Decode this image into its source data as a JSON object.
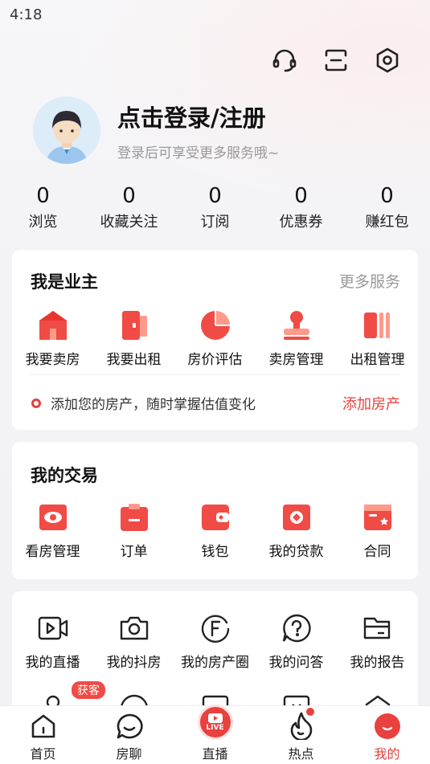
{
  "status": {
    "time": "4:18"
  },
  "header": {
    "title": "点击登录/注册",
    "subtitle": "登录后可享受更多服务哦~",
    "icons": [
      "headset-icon",
      "scan-icon",
      "settings-icon"
    ]
  },
  "stats": [
    {
      "value": "0",
      "label": "浏览"
    },
    {
      "value": "0",
      "label": "收藏关注"
    },
    {
      "value": "0",
      "label": "订阅"
    },
    {
      "value": "0",
      "label": "优惠券"
    },
    {
      "value": "0",
      "label": "赚红包"
    }
  ],
  "owner": {
    "title": "我是业主",
    "more": "更多服务",
    "items": [
      {
        "label": "我要卖房",
        "icon": "house-icon"
      },
      {
        "label": "我要出租",
        "icon": "door-icon"
      },
      {
        "label": "房价评估",
        "icon": "pie-chart-icon"
      },
      {
        "label": "卖房管理",
        "icon": "stamp-icon"
      },
      {
        "label": "出租管理",
        "icon": "books-icon"
      }
    ],
    "tip": "添加您的房产，随时掌握估值变化",
    "tip_link": "添加房产"
  },
  "trade": {
    "title": "我的交易",
    "items": [
      {
        "label": "看房管理",
        "icon": "eye-icon"
      },
      {
        "label": "订单",
        "icon": "clipboard-icon"
      },
      {
        "label": "钱包",
        "icon": "wallet-icon"
      },
      {
        "label": "我的贷款",
        "icon": "loan-icon"
      },
      {
        "label": "合同",
        "icon": "contract-icon"
      }
    ]
  },
  "tools": {
    "items": [
      {
        "label": "我的直播",
        "icon": "video-icon"
      },
      {
        "label": "我的抖房",
        "icon": "camera-icon"
      },
      {
        "label": "我的房产圈",
        "icon": "f-circle-icon"
      },
      {
        "label": "我的问答",
        "icon": "question-icon"
      },
      {
        "label": "我的报告",
        "icon": "folder-icon"
      }
    ],
    "badge": "获客"
  },
  "tabbar": {
    "items": [
      {
        "label": "首页",
        "icon": "home-icon"
      },
      {
        "label": "房聊",
        "icon": "chat-icon"
      },
      {
        "label": "直播",
        "icon": "live-icon"
      },
      {
        "label": "热点",
        "icon": "flame-icon"
      },
      {
        "label": "我的",
        "icon": "profile-icon"
      }
    ],
    "live_text": "LIVE",
    "active": "我的"
  }
}
